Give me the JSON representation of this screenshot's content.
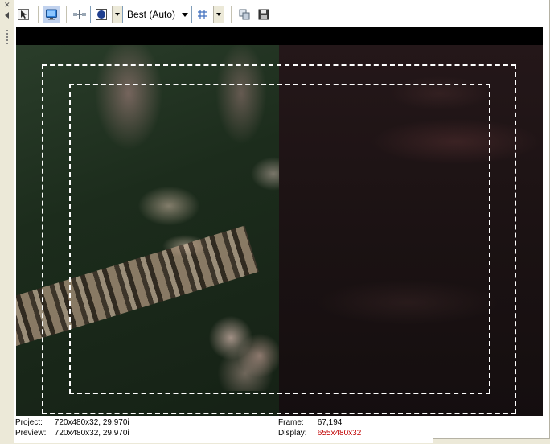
{
  "toolbar": {
    "quality_label": "Best (Auto)"
  },
  "status": {
    "project_label": "Project:",
    "project_value": "720x480x32, 29.970i",
    "preview_label": "Preview:",
    "preview_value": "720x480x32, 29.970i",
    "frame_label": "Frame:",
    "frame_value": "67,194",
    "display_label": "Display:",
    "display_value": "655x480x32"
  },
  "colors": {
    "accent": "#3169c6",
    "display_value_color": "#c00000"
  },
  "icons": {
    "close": "close-icon",
    "collapse": "collapse-arrow-icon",
    "grip": "grip-icon",
    "select": "select-arrow-icon",
    "external_monitor": "external-monitor-icon",
    "split_screen": "split-screen-icon",
    "overlays": "overlays-icon",
    "grid": "grid-icon",
    "copy_snapshot": "copy-snapshot-icon",
    "save_snapshot": "save-snapshot-icon"
  }
}
